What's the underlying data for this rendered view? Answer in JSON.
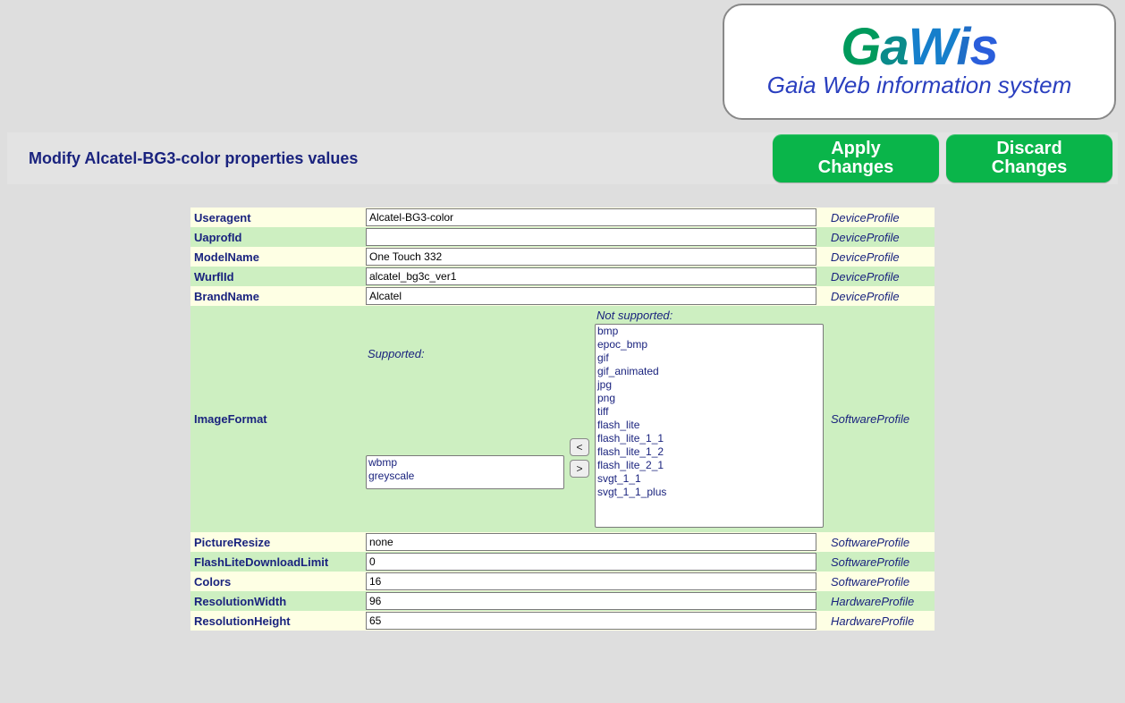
{
  "logo": {
    "chars": [
      "G",
      "a",
      "W",
      "i",
      "s"
    ],
    "subtitle": "Gaia Web information system"
  },
  "header": {
    "title": "Modify Alcatel-BG3-color properties values",
    "apply_line1": "Apply",
    "apply_line2": "Changes",
    "discard_line1": "Discard",
    "discard_line2": "Changes"
  },
  "labels": {
    "supported": "Supported:",
    "not_supported": "Not supported:"
  },
  "arrows": {
    "left": "<",
    "right": ">"
  },
  "rows": [
    {
      "key": "Useragent",
      "value": "Alcatel-BG3-color",
      "category": "DeviceProfile",
      "parity": "odd"
    },
    {
      "key": "UaprofId",
      "value": "",
      "category": "DeviceProfile",
      "parity": "even"
    },
    {
      "key": "ModelName",
      "value": "One Touch 332",
      "category": "DeviceProfile",
      "parity": "odd"
    },
    {
      "key": "WurflId",
      "value": "alcatel_bg3c_ver1",
      "category": "DeviceProfile",
      "parity": "even"
    },
    {
      "key": "BrandName",
      "value": "Alcatel",
      "category": "DeviceProfile",
      "parity": "odd"
    },
    {
      "key": "ImageFormat",
      "category": "SoftwareProfile",
      "parity": "even",
      "supported": [
        "wbmp",
        "greyscale"
      ],
      "not_supported": [
        "bmp",
        "epoc_bmp",
        "gif",
        "gif_animated",
        "jpg",
        "png",
        "tiff",
        "flash_lite",
        "flash_lite_1_1",
        "flash_lite_1_2",
        "flash_lite_2_1",
        "svgt_1_1",
        "svgt_1_1_plus"
      ]
    },
    {
      "key": "PictureResize",
      "value": "none",
      "category": "SoftwareProfile",
      "parity": "odd"
    },
    {
      "key": "FlashLiteDownloadLimit",
      "value": "0",
      "category": "SoftwareProfile",
      "parity": "even"
    },
    {
      "key": "Colors",
      "value": "16",
      "category": "SoftwareProfile",
      "parity": "odd"
    },
    {
      "key": "ResolutionWidth",
      "value": "96",
      "category": "HardwareProfile",
      "parity": "even"
    },
    {
      "key": "ResolutionHeight",
      "value": "65",
      "category": "HardwareProfile",
      "parity": "odd"
    }
  ]
}
